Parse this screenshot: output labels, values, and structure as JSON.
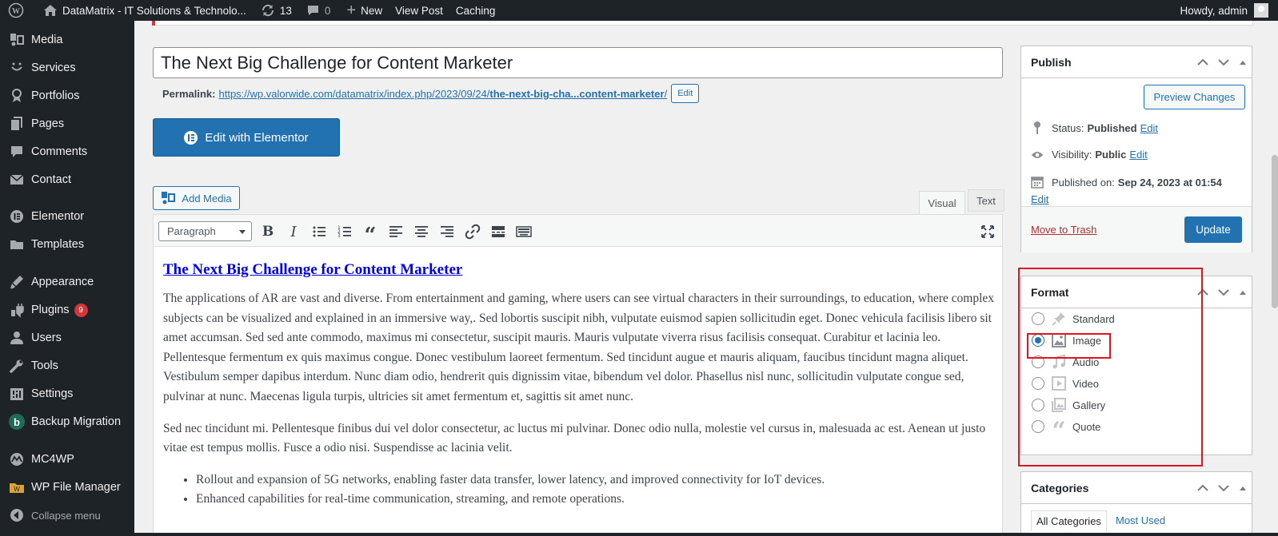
{
  "admin_bar": {
    "site_name": "DataMatrix - IT Solutions & Technolo...",
    "updates_count": "13",
    "comments_count": "0",
    "new_label": "New",
    "view_post_label": "View Post",
    "caching_label": "Caching",
    "howdy": "Howdy, admin"
  },
  "sidebar": {
    "items": [
      {
        "label": "Media",
        "icon": "media-icon"
      },
      {
        "label": "Services",
        "icon": "services-icon"
      },
      {
        "label": "Portfolios",
        "icon": "portfolios-icon"
      },
      {
        "label": "Pages",
        "icon": "pages-icon"
      },
      {
        "label": "Comments",
        "icon": "comments-icon"
      },
      {
        "label": "Contact",
        "icon": "contact-icon"
      },
      {
        "label": "Elementor",
        "icon": "elementor-icon"
      },
      {
        "label": "Templates",
        "icon": "templates-icon"
      },
      {
        "label": "Appearance",
        "icon": "appearance-icon"
      },
      {
        "label": "Plugins",
        "icon": "plugins-icon",
        "badge": "9"
      },
      {
        "label": "Users",
        "icon": "users-icon"
      },
      {
        "label": "Tools",
        "icon": "tools-icon"
      },
      {
        "label": "Settings",
        "icon": "settings-icon"
      },
      {
        "label": "Backup Migration",
        "icon": "backup-icon"
      },
      {
        "label": "MC4WP",
        "icon": "mc4wp-icon"
      },
      {
        "label": "WP File Manager",
        "icon": "file-manager-icon"
      },
      {
        "label": "Collapse menu",
        "icon": "collapse-icon"
      }
    ]
  },
  "editor": {
    "post_title": "The Next Big Challenge for Content Marketer",
    "permalink_label": "Permalink:",
    "permalink_base": "https://wp.valorwide.com/datamatrix/index.php/2023/09/24/",
    "permalink_slug": "the-next-big-cha...content-marketer",
    "permalink_trailing": "/",
    "permalink_edit": "Edit",
    "elementor_button": "Edit with Elementor",
    "add_media": "Add Media",
    "tab_visual": "Visual",
    "tab_text": "Text",
    "format_select": "Paragraph",
    "content_heading": "The Next Big Challenge for Content Marketer",
    "paragraph_1": "The applications of AR are vast and diverse. From entertainment and gaming, where users can see virtual characters in their surroundings, to education, where complex subjects can be visualized and explained in an immersive way,. Sed lobortis suscipit nibh, vulputate euismod sapien sollicitudin eget. Donec vehicula facilisis libero sit amet accumsan. Sed sed ante commodo, maximus mi consectetur, suscipit mauris. Mauris vulputate viverra risus facilisis consequat. Curabitur et lacinia leo. Pellentesque fermentum ex quis maximus congue. Donec vestibulum laoreet fermentum. Sed tincidunt augue et mauris aliquam, faucibus tincidunt magna aliquet. Vestibulum semper dapibus interdum. Nunc diam odio, hendrerit quis dignissim vitae, bibendum vel dolor. Phasellus nisl nunc, sollicitudin vulputate congue sed, pulvinar at nunc. Maecenas ligula turpis, ultricies sit amet fermentum et, sagittis sit amet nunc.",
    "paragraph_2": "Sed nec tincidunt mi. Pellentesque finibus dui vel dolor consectetur, ac luctus mi pulvinar. Donec odio nulla, molestie vel cursus in, malesuada ac est. Aenean ut justo vitae est tempus mollis. Fusce a odio nisi. Suspendisse ac lacinia velit.",
    "bullets": [
      "Rollout and expansion of 5G networks, enabling faster data transfer, lower latency, and improved connectivity for IoT devices.",
      "Enhanced capabilities for real-time communication, streaming, and remote operations."
    ]
  },
  "publish": {
    "title": "Publish",
    "preview_button": "Preview Changes",
    "status_label": "Status:",
    "status_value": "Published",
    "visibility_label": "Visibility:",
    "visibility_value": "Public",
    "published_label": "Published on:",
    "published_value": "Sep 24, 2023 at 01:54",
    "edit_label": "Edit",
    "trash_label": "Move to Trash",
    "update_button": "Update"
  },
  "format_box": {
    "title": "Format",
    "options": [
      {
        "label": "Standard",
        "icon": "pin-icon",
        "checked": false
      },
      {
        "label": "Image",
        "icon": "image-icon",
        "checked": true
      },
      {
        "label": "Audio",
        "icon": "audio-icon",
        "checked": false
      },
      {
        "label": "Video",
        "icon": "video-icon",
        "checked": false
      },
      {
        "label": "Gallery",
        "icon": "gallery-icon",
        "checked": false
      },
      {
        "label": "Quote",
        "icon": "quote-icon",
        "checked": false
      }
    ]
  },
  "categories": {
    "title": "Categories",
    "tab_all": "All Categories",
    "tab_most_used": "Most Used"
  },
  "colors": {
    "admin_dark": "#1d2327",
    "primary_blue": "#2271b1",
    "highlight_red": "#e0141e",
    "badge_red": "#d63638"
  }
}
